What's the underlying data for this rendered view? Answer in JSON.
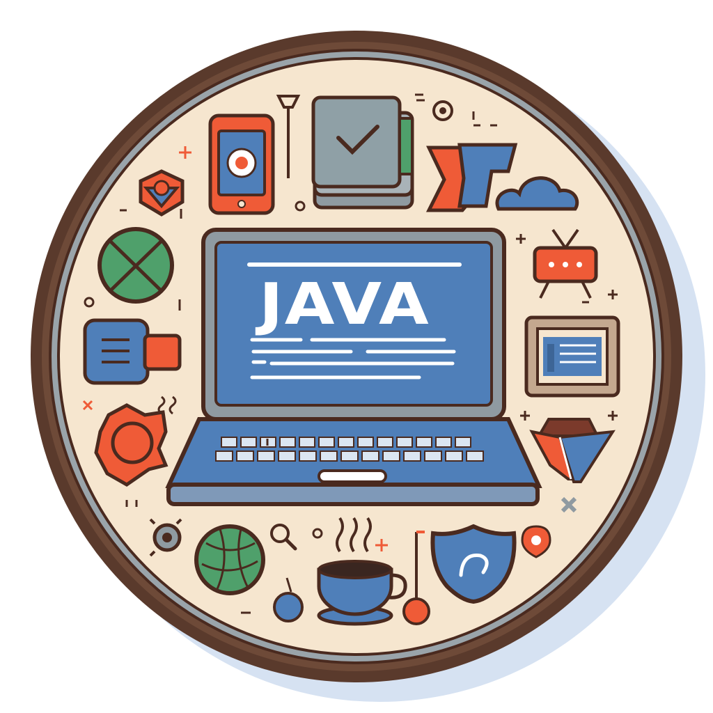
{
  "screen": {
    "title": "JAVA"
  },
  "colors": {
    "outline": "#4a2a1f",
    "rim": "#5a3a2c",
    "cream": "#f6e6cf",
    "blue": "#4f7fb9",
    "orange": "#ef5b37",
    "green": "#4fa06b",
    "gray": "#8f9aa1",
    "shadow": "#c9d6ea"
  },
  "icons": [
    "smartphone-gear-icon",
    "pin-stand-icon",
    "document-stack-check-icon",
    "target-dot-icon",
    "flag-cloud-icon",
    "hex-badge-icon",
    "globe-icon",
    "tv-chat-icon",
    "usb-connector-icon",
    "document-frame-icon",
    "hexagon-nut-icon",
    "box-icon",
    "gear-icon",
    "globe-small-icon",
    "search-icon",
    "coffee-cup-icon",
    "apple-icon",
    "flag-pin-icon",
    "shield-icon",
    "pin-marker-icon"
  ]
}
